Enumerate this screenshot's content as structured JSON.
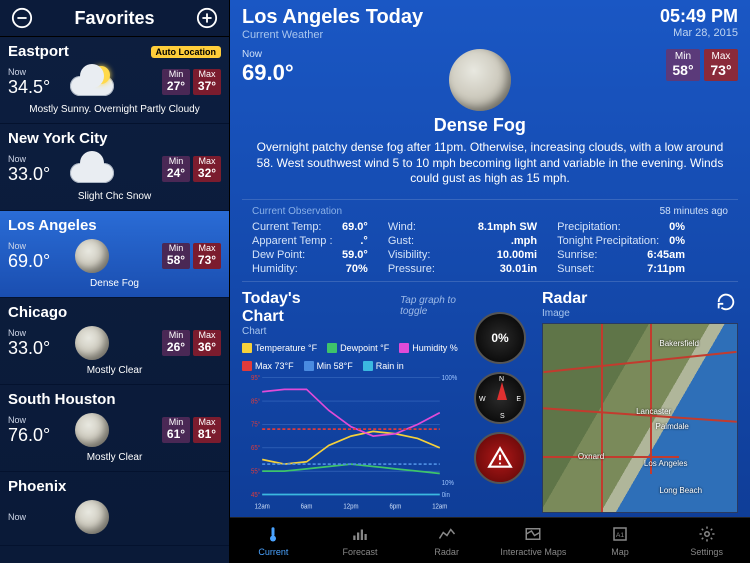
{
  "sidebar": {
    "title": "Favorites",
    "auto_location_label": "Auto Location",
    "items": [
      {
        "city": "Eastport",
        "now_label": "Now",
        "temp": "34.5°",
        "min_label": "Min",
        "min": "27°",
        "max_label": "Max",
        "max": "37°",
        "cond": "Mostly Sunny. Overnight Partly Cloudy",
        "icon": "sun-cloud",
        "auto": true
      },
      {
        "city": "New York City",
        "now_label": "Now",
        "temp": "33.0°",
        "min_label": "Min",
        "min": "24°",
        "max_label": "Max",
        "max": "32°",
        "cond": "Slight Chc Snow",
        "icon": "snow-cloud"
      },
      {
        "city": "Los Angeles",
        "now_label": "Now",
        "temp": "69.0°",
        "min_label": "Min",
        "min": "58°",
        "max_label": "Max",
        "max": "73°",
        "cond": "Dense Fog",
        "icon": "moon",
        "selected": true
      },
      {
        "city": "Chicago",
        "now_label": "Now",
        "temp": "33.0°",
        "min_label": "Min",
        "min": "26°",
        "max_label": "Max",
        "max": "36°",
        "cond": "Mostly Clear",
        "icon": "moon"
      },
      {
        "city": "South Houston",
        "now_label": "Now",
        "temp": "76.0°",
        "min_label": "Min",
        "min": "61°",
        "max_label": "Max",
        "max": "81°",
        "cond": "Mostly Clear",
        "icon": "moon"
      },
      {
        "city": "Phoenix",
        "now_label": "Now",
        "temp": "",
        "min_label": "",
        "min": "",
        "max_label": "",
        "max": "",
        "cond": "",
        "icon": "moon"
      }
    ]
  },
  "header": {
    "title": "Los Angeles Today",
    "sub": "Current Weather",
    "time": "05:49 PM",
    "date": "Mar 28, 2015"
  },
  "summary": {
    "now_label": "Now",
    "temp": "69.0°",
    "min_label": "Min",
    "min": "58°",
    "max_label": "Max",
    "max": "73°",
    "cond": "Dense Fog",
    "desc": "Overnight patchy dense fog after 11pm.  Otherwise, increasing clouds, with a low around 58. West southwest wind 5 to 10 mph becoming light and variable  in the evening. Winds could gust as high as 15 mph."
  },
  "obs": {
    "heading": "Current Observation",
    "ago": "58 minutes ago",
    "col1": [
      {
        "k": "Current Temp:",
        "v": "69.0°"
      },
      {
        "k": "Apparent Temp :",
        "v": ".°"
      },
      {
        "k": "Dew Point:",
        "v": "59.0°"
      },
      {
        "k": "Humidity:",
        "v": "70%"
      }
    ],
    "col2": [
      {
        "k": "Wind:",
        "v": "8.1mph SW"
      },
      {
        "k": "Gust:",
        "v": ".mph"
      },
      {
        "k": "Visibility:",
        "v": "10.00mi"
      },
      {
        "k": "Pressure:",
        "v": "30.01in"
      }
    ],
    "col3": [
      {
        "k": "Precipitation:",
        "v": "0%"
      },
      {
        "k": "Tonight Precipitation:",
        "v": "0%"
      },
      {
        "k": "Sunrise:",
        "v": "6:45am"
      },
      {
        "k": "Sunset:",
        "v": "7:11pm"
      }
    ]
  },
  "chart": {
    "title": "Today's Chart",
    "sub": "Chart",
    "hint": "Tap graph to toggle",
    "legend": [
      {
        "label": "Temperature °F",
        "color": "#f5d13b"
      },
      {
        "label": "Dewpoint °F",
        "color": "#3ec46a"
      },
      {
        "label": "Humidity %",
        "color": "#e04bd8"
      },
      {
        "label": "Max 73°F",
        "color": "#e03b3b"
      },
      {
        "label": "Min 58°F",
        "color": "#4a8be0"
      },
      {
        "label": "Rain in",
        "color": "#3bb8e0"
      }
    ]
  },
  "gauges": {
    "precip": "0%",
    "compass": {
      "n": "N",
      "e": "E",
      "s": "S",
      "w": "W"
    }
  },
  "radar": {
    "title": "Radar",
    "sub": "Image",
    "places": [
      "Bakersfield",
      "Lancaster",
      "Palmdale",
      "Oxnard",
      "Los Angeles",
      "Long Beach"
    ]
  },
  "tabs": [
    {
      "label": "Current",
      "icon": "thermo"
    },
    {
      "label": "Forecast",
      "icon": "forecast"
    },
    {
      "label": "Radar",
      "icon": "radar"
    },
    {
      "label": "Interactive Maps",
      "icon": "imaps"
    },
    {
      "label": "Map",
      "icon": "map"
    },
    {
      "label": "Settings",
      "icon": "gear"
    }
  ],
  "chart_data": {
    "type": "line",
    "title": "Today's Chart",
    "xlabel": "",
    "ylabel": "°F",
    "y2label": "%",
    "x": [
      "12am",
      "6am",
      "12pm",
      "6pm",
      "12am"
    ],
    "ylim": [
      45,
      95
    ],
    "y2lim": [
      0,
      100
    ],
    "series": [
      {
        "name": "Temperature °F",
        "axis": "y",
        "values": [
          60,
          58,
          59,
          66,
          70,
          72,
          71,
          69,
          65
        ]
      },
      {
        "name": "Dewpoint °F",
        "axis": "y",
        "values": [
          55,
          55,
          56,
          57,
          58,
          57,
          56,
          55,
          54
        ]
      },
      {
        "name": "Humidity %",
        "axis": "y2",
        "values": [
          88,
          90,
          90,
          72,
          58,
          50,
          52,
          60,
          70
        ]
      },
      {
        "name": "Max 73°F",
        "axis": "y",
        "values": [
          73,
          73,
          73,
          73,
          73,
          73,
          73,
          73,
          73
        ]
      },
      {
        "name": "Min 58°F",
        "axis": "y",
        "values": [
          58,
          58,
          58,
          58,
          58,
          58,
          58,
          58,
          58
        ]
      },
      {
        "name": "Rain in",
        "axis": "y2",
        "values": [
          0,
          0,
          0,
          0,
          0,
          0,
          0,
          0,
          0
        ]
      }
    ],
    "xticks": [
      "12am",
      "6am",
      "12pm",
      "6pm",
      "12am"
    ],
    "yticks": [
      45,
      55,
      65,
      75,
      85,
      95
    ],
    "y2ticks": [
      "0in",
      "10%",
      "100%"
    ]
  }
}
